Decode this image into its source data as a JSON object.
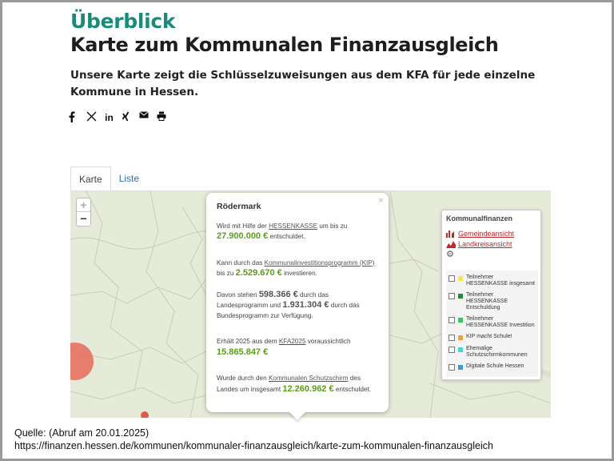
{
  "header": {
    "eyebrow": "Überblick",
    "title": "Karte zum Kommunalen Finanzausgleich",
    "lead": "Unsere Karte zeigt die Schlüsselzuweisungen aus dem KFA für jede einzelne Kommune in Hessen."
  },
  "share": {
    "icons": [
      "facebook-icon",
      "x-icon",
      "linkedin-icon",
      "xing-icon",
      "mail-icon",
      "print-icon"
    ],
    "linkedin_label": "in"
  },
  "tabs": [
    {
      "label": "Karte",
      "active": true
    },
    {
      "label": "Liste",
      "active": false
    }
  ],
  "map": {
    "zoom_in": "+",
    "zoom_out": "−",
    "popup": {
      "title": "Rödermark",
      "close": "×",
      "p1_pre": "Wird mit Hilfe der ",
      "p1_link": "HESSENKASSE",
      "p1_mid": " um bis zu ",
      "p1_value": "27.900.000 €",
      "p1_post": " entschuldet.",
      "p2_pre": "Kann durch das ",
      "p2_link": "Kommunalinvestitionsprogramm (KIP)",
      "p2_mid": " bis zu ",
      "p2_value": "2.529.670 €",
      "p2_post": " investieren.",
      "p3_pre": "Davon stehen ",
      "p3_value1": "598.366 €",
      "p3_mid1": " durch das Landesprogramm und ",
      "p3_value2": "1.931.304 €",
      "p3_post": " durch das Bundesprogramm zur Verfügung.",
      "p4_pre": "Erhält 2025 aus dem ",
      "p4_link": "KFA2025",
      "p4_mid": " voraussichtlich",
      "p4_value": "15.865.847 €",
      "p5_pre": "Wurde durch den ",
      "p5_link": "Kommunalen Schutzschirm",
      "p5_mid": " des Landes um insgesamt ",
      "p5_value": "12.260.962 €",
      "p5_post": " entschuldet."
    },
    "legend": {
      "title": "Kommunalfinanzen",
      "links": [
        "Gemeindeansicht",
        "Landkreisansicht"
      ],
      "items": [
        {
          "label": "Teilnehmer HESSENKASSE insgesamt",
          "color": "#f5e94a"
        },
        {
          "label": "Teilnehmer HESSENKASSE Entschuldung",
          "color": "#1e8a3a"
        },
        {
          "label": "Teilnehmer HESSENKASSE Investition",
          "color": "#2ecc5a"
        },
        {
          "label": "KIP macht Schule!",
          "color": "#f0a040"
        },
        {
          "label": "Ehemalige Schutzschirmkommunen",
          "color": "#40d8d0"
        },
        {
          "label": "Digitale Schule Hessen",
          "color": "#3a9ae0"
        }
      ]
    }
  },
  "source": {
    "line1": "Quelle: (Abruf am 20.01.2025)",
    "line2": "https://finanzen.hessen.de/kommunen/kommunaler-finanzausgleich/karte-zum-kommunalen-finanzausgleich"
  }
}
